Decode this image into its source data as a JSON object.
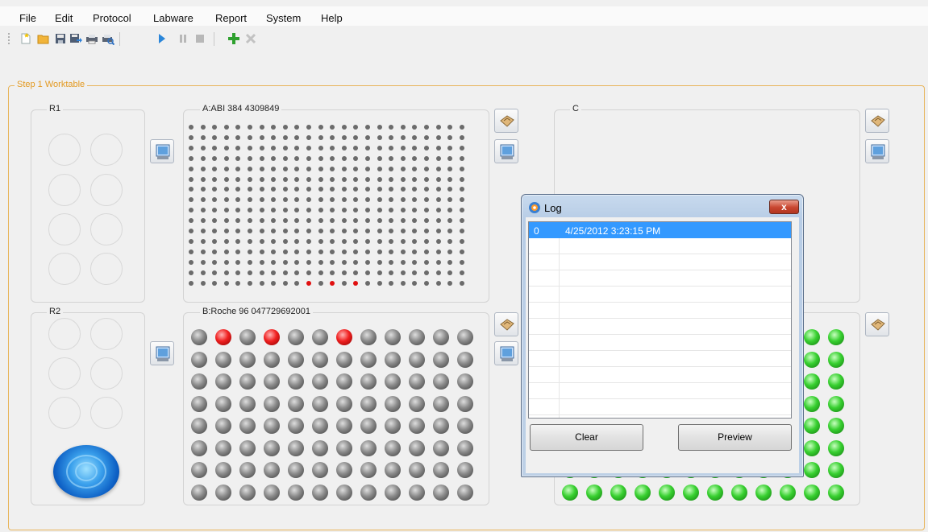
{
  "menu": [
    "File",
    "Edit",
    "Protocol",
    "Labware",
    "Report",
    "System",
    "Help"
  ],
  "toolbar": {
    "icons": [
      "new-icon",
      "open-folder-icon",
      "save-icon",
      "save-as-icon",
      "print-icon",
      "print-preview-icon",
      "run-icon",
      "pause-icon",
      "stop-icon",
      "add-icon",
      "delete-icon"
    ]
  },
  "worktable": {
    "title": "Step 1 Worktable",
    "r1": {
      "title": "R1"
    },
    "r2": {
      "title": "R2"
    },
    "plate_a": {
      "title": "A:ABI 384 4309849",
      "rows": 16,
      "cols": 24,
      "red_wells": [
        [
          15,
          10
        ],
        [
          15,
          12
        ],
        [
          15,
          14
        ]
      ]
    },
    "plate_b": {
      "title": "B:Roche 96 047729692001",
      "rows": 8,
      "cols": 12,
      "red_wells": [
        [
          0,
          1
        ],
        [
          0,
          3
        ],
        [
          0,
          6
        ]
      ]
    },
    "plate_c": {
      "title": "C"
    },
    "plate_d": {
      "rows": 8,
      "visible_cols": 12,
      "well_color": "green"
    }
  },
  "log": {
    "title": "Log",
    "close_label": "x",
    "rows": [
      {
        "index": "0",
        "time": "4/25/2012 3:23:15 PM"
      }
    ],
    "clear_label": "Clear",
    "preview_label": "Preview"
  },
  "colors": {
    "accent_orange": "#e39a22",
    "selection_blue": "#3399ff",
    "well_red": "#f02020",
    "well_green": "#38d030",
    "well_gray": "#8a8a8a"
  }
}
